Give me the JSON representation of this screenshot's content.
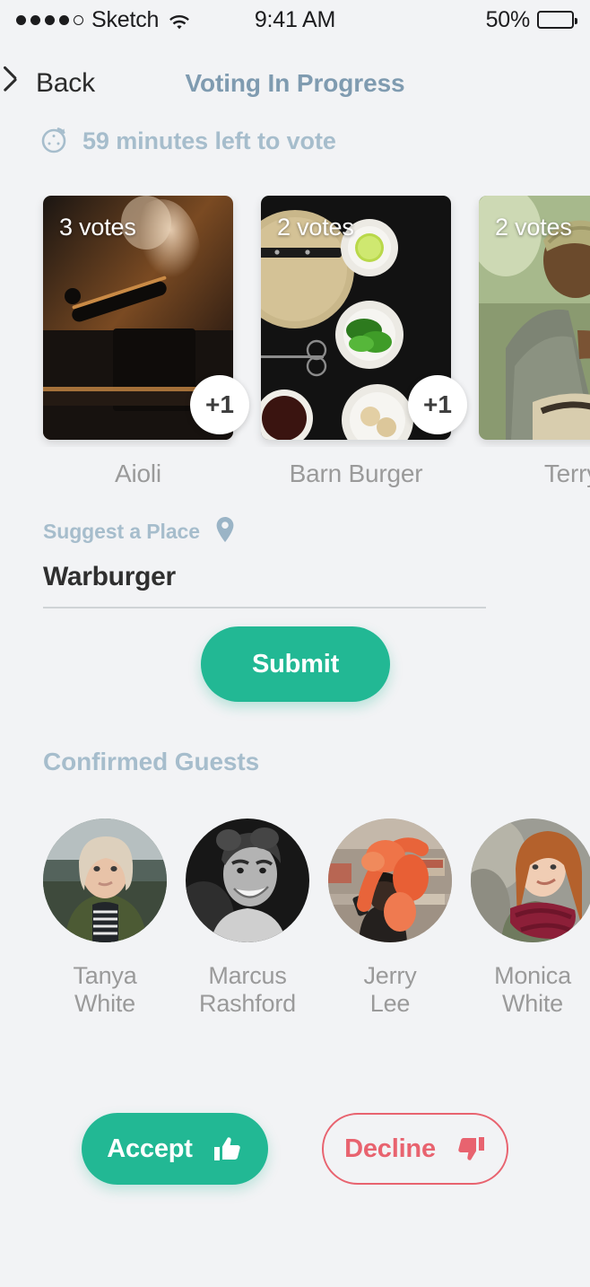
{
  "status_bar": {
    "signal_dots_filled": 4,
    "signal_dots_total": 5,
    "carrier": "Sketch",
    "wifi_icon": "wifi-icon",
    "time": "9:41 AM",
    "battery_percent": "50%",
    "battery_level": 50,
    "battery_color": "#fdcb1a"
  },
  "nav": {
    "back_label": "Back",
    "back_icon": "chevron-left-icon",
    "title": "Voting In Progress",
    "title_color": "#7f9bb0"
  },
  "timer": {
    "icon": "stopwatch-icon",
    "text": "59 minutes left to vote",
    "color": "#a6bdcc"
  },
  "places": [
    {
      "name": "Aioli",
      "votes": "3 votes",
      "vote_button": "+1",
      "image": "steaming-pot-photo"
    },
    {
      "name": "Barn Burger",
      "votes": "2 votes",
      "vote_button": "+1",
      "image": "ingredient-bowls-photo"
    },
    {
      "name": "Terry'",
      "votes": "2 votes",
      "vote_button": "",
      "image": "person-outdoors-photo"
    }
  ],
  "suggest": {
    "label": "Suggest a Place",
    "icon": "map-pin-icon",
    "value": "Warburger",
    "placeholder": "Warburger"
  },
  "submit": {
    "label": "Submit",
    "color": "#22b894"
  },
  "guests_section": {
    "title": "Confirmed Guests",
    "guests": [
      {
        "first_name": "Tanya",
        "last_name": "White",
        "avatar": "blonde-woman-avatar"
      },
      {
        "first_name": "Marcus",
        "last_name": "Rashford",
        "avatar": "smiling-man-avatar"
      },
      {
        "first_name": "Jerry",
        "last_name": "Lee",
        "avatar": "smoke-flare-avatar"
      },
      {
        "first_name": "Monica",
        "last_name": "White",
        "avatar": "redhead-woman-avatar"
      }
    ]
  },
  "actions": {
    "accept_label": "Accept",
    "accept_icon": "thumbs-up-icon",
    "accept_color": "#22b894",
    "decline_label": "Decline",
    "decline_icon": "thumbs-down-icon",
    "decline_color": "#e8636f"
  }
}
